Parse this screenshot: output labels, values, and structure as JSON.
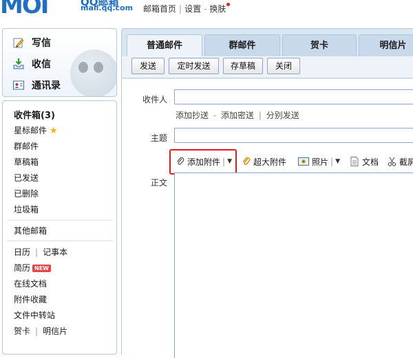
{
  "logo": {
    "mark": "MOI",
    "brand": "QQ邮箱",
    "domain": "mail.qq.com"
  },
  "top_links": {
    "home": "邮箱首页",
    "settings": "设置",
    "theme": "换肤"
  },
  "quick_actions": [
    {
      "label": "写信",
      "icon": "pencil-icon"
    },
    {
      "label": "收信",
      "icon": "inbox-download-icon"
    },
    {
      "label": "通讯录",
      "icon": "contacts-icon"
    }
  ],
  "folders": {
    "inbox": "收件箱(3)",
    "starred": "星标邮件",
    "group": "群邮件",
    "drafts": "草稿箱",
    "sent": "已发送",
    "deleted": "已删除",
    "spam": "垃圾箱"
  },
  "other_mailbox": "其他邮箱",
  "apps": {
    "calendar": "日历",
    "notes": "记事本",
    "resume": "简历",
    "new_badge": "NEW",
    "online_docs": "在线文档",
    "attachments": "附件收藏",
    "file_transfer": "文件中转站",
    "greeting_card": "贺卡",
    "postcard": "明信片"
  },
  "tabs": [
    "普通邮件",
    "群邮件",
    "贺卡",
    "明信片"
  ],
  "toolbar": {
    "send": "发送",
    "scheduled": "定时发送",
    "save_draft": "存草稿",
    "close": "关闭"
  },
  "compose": {
    "to_label": "收件人",
    "add_cc": "添加抄送",
    "dash": "-",
    "add_bcc": "添加密送",
    "separate": "分别发送",
    "subject_label": "主题",
    "body_label": "正文"
  },
  "attach_tools": {
    "add_attachment": "添加附件",
    "large_attachment": "超大附件",
    "photo": "照片",
    "document": "文档",
    "screenshot": "截屏"
  },
  "colors": {
    "brand_blue": "#1f6fc5",
    "highlight_red": "#e31b1b",
    "panel_bg": "#dae5f2"
  }
}
